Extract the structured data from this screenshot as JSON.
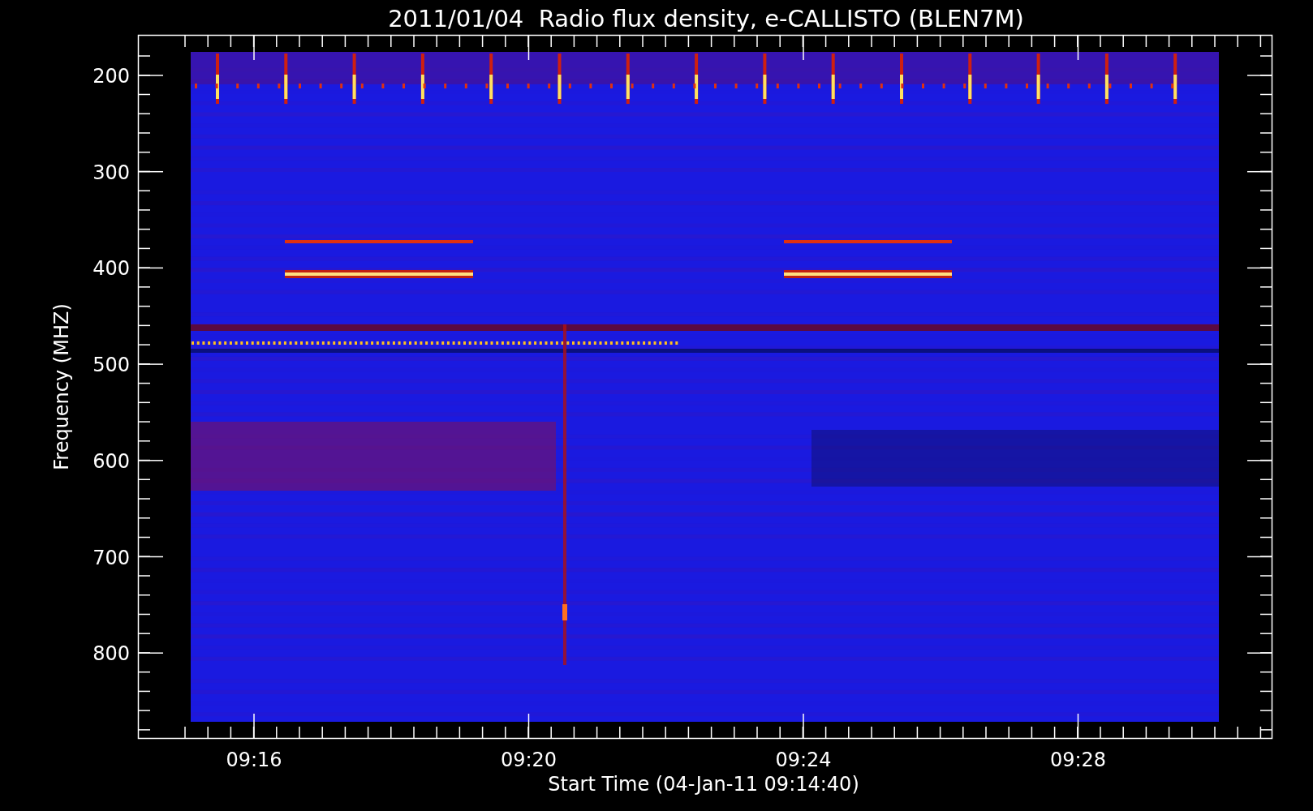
{
  "title": "2011/01/04  Radio flux density, e-CALLISTO (BLEN7M)",
  "y_axis": {
    "label": "Frequency (MHZ)",
    "ticks": [
      "200",
      "300",
      "400",
      "500",
      "600",
      "700",
      "800"
    ]
  },
  "x_axis": {
    "label": "Start Time (04-Jan-11 09:14:40)",
    "ticks": [
      "09:16",
      "09:20",
      "09:24",
      "09:28"
    ]
  }
}
